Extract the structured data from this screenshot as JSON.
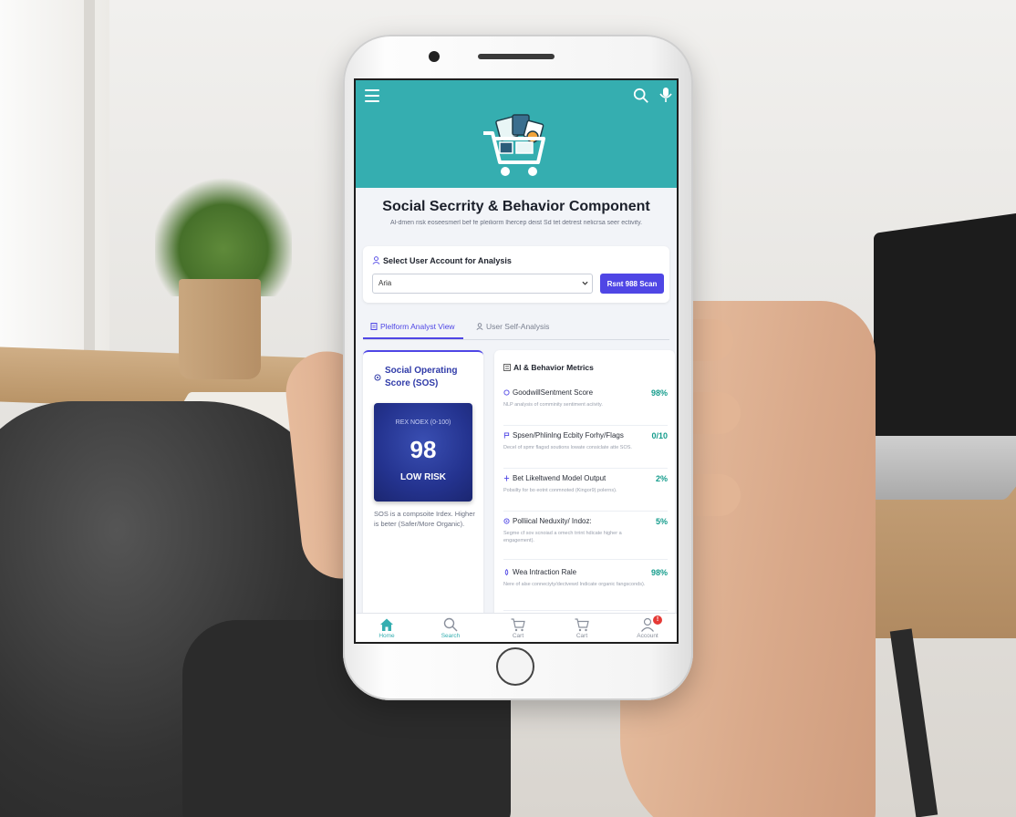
{
  "header": {
    "menu_icon": "hamburger-menu-icon",
    "search_icon": "search-icon",
    "mic_icon": "microphone-icon",
    "logo_icon": "shopping-cart-logo-icon",
    "color": "#35aeb0"
  },
  "page": {
    "title": "Social Secrrity & Behavior Component",
    "subtitle": "Al-dmen risk eoseesmerl bef fe pleiliorm lhercep deist Sd tet detrest nelicrsa seer ectivity."
  },
  "account_select": {
    "label": "Select User Account for Analysis",
    "selected": "Aria",
    "run_button": "Rsnt 988 Scan",
    "accent": "#4f46e5"
  },
  "tabs": [
    {
      "label": "Plelform Analyst View",
      "active": true
    },
    {
      "label": "User Self-Analysis",
      "active": false
    }
  ],
  "score_card": {
    "title": "Social Operating Score (SOS)",
    "label": "REX NOEX (0-100)",
    "value": "98",
    "risk": "LOW RISK",
    "description": "SOS is a compsoite Irdex. Higher is beter (Safer/More Organic)."
  },
  "metrics": {
    "title": "Al & Behavior Metrics",
    "items": [
      {
        "name": "GoodwillSentment Score",
        "value": "98%",
        "desc": "NLP analysis of comminity sentiment aciivity."
      },
      {
        "name": "Spsen/Phlinlng Ecbity Forhy/Flags",
        "value": "0/10",
        "desc": "Decel of spmr flagsd soutions lowate consiclate atte SOS."
      },
      {
        "name": "Bet Likeltwend Model Output",
        "value": "2%",
        "desc": "Pobsilty for bo eotnt conmnoted (Kingor9) polerns)."
      },
      {
        "name": "Polliical Neduxity/ Indoz:",
        "value": "5%",
        "desc": "Segme cf sov scnoiad a omech trrint hdicate higher a engagement)."
      },
      {
        "name": "Wea Intraction Rale",
        "value": "98%",
        "desc": "Nere of alse conneciyty/dectvewd Indicate organic fangsconds)."
      }
    ]
  },
  "bottom_nav": [
    {
      "label": "Home",
      "icon": "home-icon"
    },
    {
      "label": "Search",
      "icon": "search-icon"
    },
    {
      "label": "Cart",
      "icon": "cart-icon"
    },
    {
      "label": "Cart",
      "icon": "cart-icon"
    },
    {
      "label": "Account",
      "icon": "account-icon",
      "badge": "!"
    }
  ]
}
